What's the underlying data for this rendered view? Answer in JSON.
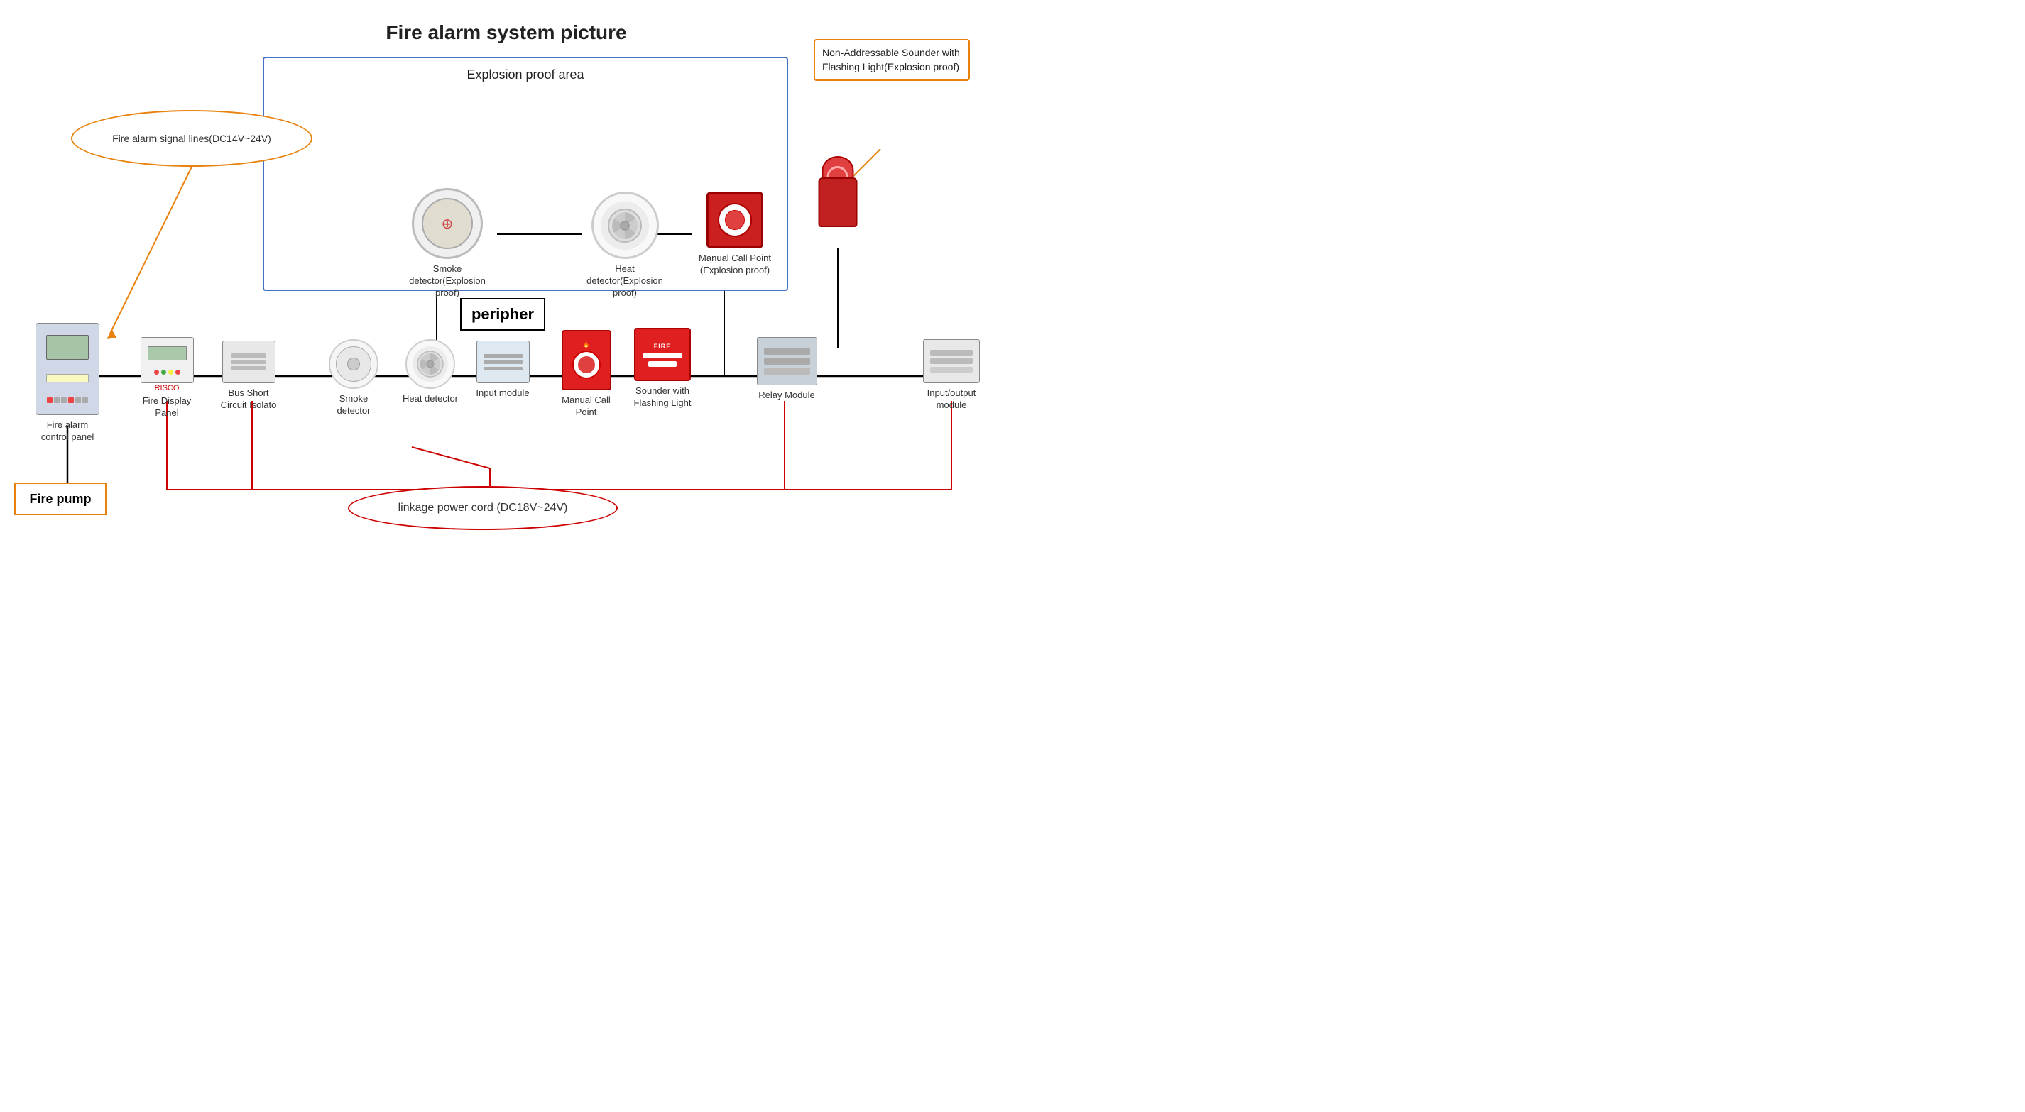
{
  "title": "Fire alarm system picture",
  "explosion_area_label": "Explosion proof area",
  "sounder_callout": {
    "text": "Non-Addressable Sounder with Flashing Light(Explosion proof)"
  },
  "signal_ellipse": {
    "text": "Fire alarm signal lines(DC14V~24V)"
  },
  "peripher_box": {
    "text": "peripher"
  },
  "fire_pump_box": {
    "text": "Fire pump"
  },
  "power_ellipse": {
    "text": "linkage power cord (DC18V~24V)"
  },
  "components": {
    "fire_alarm_panel_label": "Fire alarm control panel",
    "fire_display_panel_label": "Fire Display Panel",
    "bus_isolator_label": "Bus Short Circuit Isolato",
    "smoke_detector_label": "Smoke detector",
    "heat_detector_label": "Heat detector",
    "input_module_label": "Input module",
    "manual_call_point_label": "Manual Call Point",
    "sounder_label": "Sounder with Flashing Light",
    "relay_module_label": "Relay Module",
    "io_module_label": "Input/output module",
    "exp_smoke_label": "Smoke detector(Explosion proof)",
    "exp_heat_label": "Heat detector(Explosion proof)",
    "exp_mcp_label": "Manual Call Point (Explosion proof)",
    "exp_sounder_label": "Non-Addressable Sounder with Flashing Light(Explosion proof)"
  }
}
